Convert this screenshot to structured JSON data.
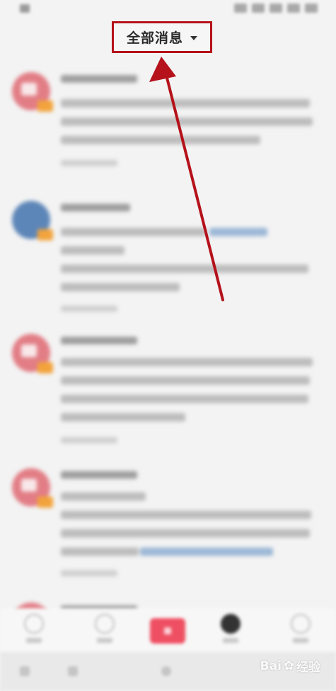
{
  "header": {
    "title": "全部消息",
    "dropdown_icon": "caret-down-icon"
  },
  "annotation": {
    "box_color": "#b5121b",
    "arrow_color": "#b5121b"
  },
  "feed": {
    "avatar_color_primary": "#e27d85",
    "avatar_color_secondary": "#5d86b8",
    "link_color": "#9db8d6"
  },
  "bottom_nav": {
    "publish_button_color": "#ef4f62",
    "icons": [
      "home-icon",
      "discover-icon",
      "publish-icon",
      "messages-icon",
      "profile-icon"
    ]
  },
  "watermark": {
    "text": "Bai",
    "suffix": "经验"
  }
}
